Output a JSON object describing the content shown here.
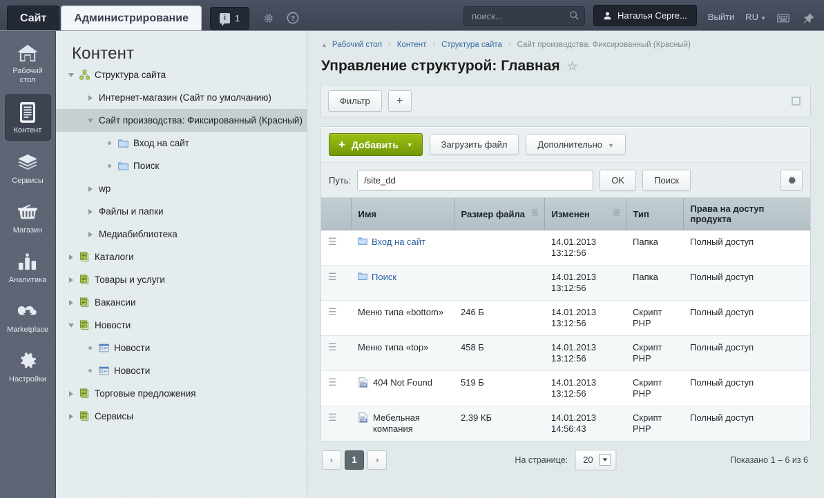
{
  "topbar": {
    "tab_site": "Сайт",
    "tab_admin": "Администрирование",
    "notifications_count": "1",
    "gear_icon": "gear-icon",
    "help_icon": "help-icon",
    "search_placeholder": "поиск...",
    "search_value": "",
    "user_name": "Наталья Серге...",
    "logout": "Выйти",
    "language": "RU",
    "keyboard_icon": "keyboard-icon",
    "pin_icon": "pin-icon"
  },
  "rail": {
    "items": [
      {
        "label": "Рабочий стол",
        "icon": "home-icon",
        "selected": false
      },
      {
        "label": "Контент",
        "icon": "content-icon",
        "selected": true
      },
      {
        "label": "Сервисы",
        "icon": "layers-icon",
        "selected": false
      },
      {
        "label": "Магазин",
        "icon": "basket-icon",
        "selected": false
      },
      {
        "label": "Аналитика",
        "icon": "bar-chart-icon",
        "selected": false
      },
      {
        "label": "Marketplace",
        "icon": "cloud-download-icon",
        "selected": false
      },
      {
        "label": "Настройки",
        "icon": "gear-icon",
        "selected": false
      }
    ]
  },
  "tree": {
    "title": "Контент",
    "nodes": [
      {
        "label": "Структура сайта",
        "indent": 0,
        "toggle": "down",
        "icon": "sitemap-icon",
        "selected": false
      },
      {
        "label": "Интернет-магазин (Сайт по умолчанию)",
        "indent": 1,
        "toggle": "right",
        "icon": "none",
        "selected": false
      },
      {
        "label": "Сайт производства: Фиксированный (Красный)",
        "indent": 1,
        "toggle": "down",
        "icon": "none",
        "selected": true
      },
      {
        "label": "Вход на сайт",
        "indent": 2,
        "toggle": "dot",
        "icon": "folder-icon",
        "selected": false
      },
      {
        "label": "Поиск",
        "indent": 2,
        "toggle": "dot",
        "icon": "folder-icon",
        "selected": false
      },
      {
        "label": "wp",
        "indent": 1,
        "toggle": "right",
        "icon": "none",
        "selected": false
      },
      {
        "label": "Файлы и папки",
        "indent": 1,
        "toggle": "right",
        "icon": "none",
        "selected": false
      },
      {
        "label": "Медиабиблиотека",
        "indent": 1,
        "toggle": "right",
        "icon": "none",
        "selected": false
      },
      {
        "label": "Каталоги",
        "indent": 0,
        "toggle": "right",
        "icon": "iblock-icon",
        "selected": false
      },
      {
        "label": "Товары и услуги",
        "indent": 0,
        "toggle": "right",
        "icon": "iblock-icon",
        "selected": false
      },
      {
        "label": "Вакансии",
        "indent": 0,
        "toggle": "right",
        "icon": "iblock-icon",
        "selected": false
      },
      {
        "label": "Новости",
        "indent": 0,
        "toggle": "down",
        "icon": "iblock-icon",
        "selected": false
      },
      {
        "label": "Новости",
        "indent": 1,
        "toggle": "dot",
        "icon": "news-icon",
        "selected": false
      },
      {
        "label": "Новости",
        "indent": 1,
        "toggle": "dot",
        "icon": "news-icon",
        "selected": false
      },
      {
        "label": "Торговые предложения",
        "indent": 0,
        "toggle": "right",
        "icon": "iblock-icon",
        "selected": false
      },
      {
        "label": "Сервисы",
        "indent": 0,
        "toggle": "right",
        "icon": "iblock-icon",
        "selected": false
      }
    ]
  },
  "breadcrumbs": [
    {
      "label": "Рабочий стол",
      "last": false
    },
    {
      "label": "Контент",
      "last": false
    },
    {
      "label": "Структура сайта",
      "last": false
    },
    {
      "label": "Сайт производства: Фиксированный (Красный)",
      "last": true
    }
  ],
  "page": {
    "title": "Управление структурой: Главная",
    "favorite_icon": "star-icon"
  },
  "filterbar": {
    "filter_label": "Фильтр",
    "add_filter_label": "+",
    "collapse_icon": "collapse-icon"
  },
  "toolbar": {
    "add_label": "Добавить",
    "add_plus": "+",
    "upload_label": "Загрузить файл",
    "more_label": "Дополнительно",
    "settings_icon": "gear-icon"
  },
  "pathbar": {
    "label": "Путь:",
    "value": "/site_dd",
    "placeholder": "",
    "ok_label": "OK",
    "search_label": "Поиск"
  },
  "grid": {
    "columns": [
      {
        "label": "",
        "menu": false
      },
      {
        "label": "Имя",
        "menu": false
      },
      {
        "label": "Размер файла",
        "menu": true
      },
      {
        "label": "Изменен",
        "menu": true
      },
      {
        "label": "Тип",
        "menu": false
      },
      {
        "label": "Права на доступ продукта",
        "menu": false
      }
    ],
    "rows": [
      {
        "name": "Вход на сайт",
        "icon": "folder-icon",
        "link": true,
        "size": "",
        "modified": "14.01.2013 13:12:56",
        "type": "Папка",
        "rights": "Полный доступ"
      },
      {
        "name": "Поиск",
        "icon": "folder-icon",
        "link": true,
        "size": "",
        "modified": "14.01.2013 13:12:56",
        "type": "Папка",
        "rights": "Полный доступ"
      },
      {
        "name": "Меню типа «bottom»",
        "icon": "none",
        "link": false,
        "size": "246 Б",
        "modified": "14.01.2013 13:12:56",
        "type": "Скрипт PHP",
        "rights": "Полный доступ"
      },
      {
        "name": "Меню типа «top»",
        "icon": "none",
        "link": false,
        "size": "458 Б",
        "modified": "14.01.2013 13:12:56",
        "type": "Скрипт PHP",
        "rights": "Полный доступ"
      },
      {
        "name": "404 Not Found",
        "icon": "php-icon",
        "link": false,
        "size": "519 Б",
        "modified": "14.01.2013 13:12:56",
        "type": "Скрипт PHP",
        "rights": "Полный доступ"
      },
      {
        "name": "Мебельная компания",
        "icon": "php-icon",
        "link": false,
        "size": "2.39 КБ",
        "modified": "14.01.2013 14:56:43",
        "type": "Скрипт PHP",
        "rights": "Полный доступ"
      }
    ]
  },
  "pager": {
    "prev": "‹",
    "current": "1",
    "next": "›",
    "per_page_label": "На странице:",
    "per_page_value": "20",
    "shown": "Показано 1 – 6 из 6"
  },
  "colors": {
    "accent_green": "#8db510",
    "link_blue": "#2a5fa3",
    "topbar_dark": "#3d4453",
    "rail_grey": "#5c6372"
  }
}
